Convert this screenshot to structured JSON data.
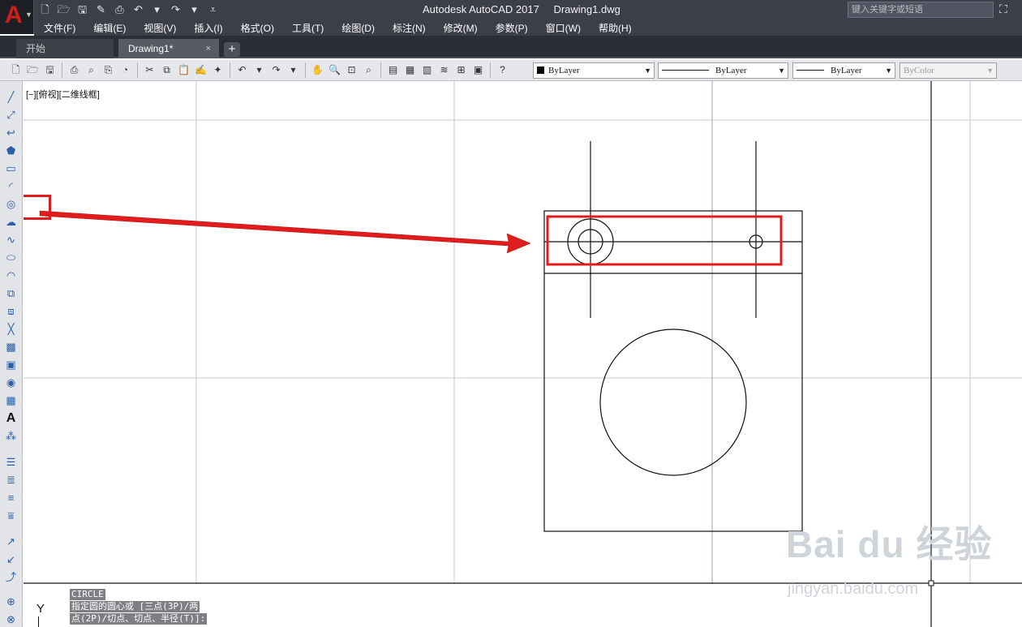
{
  "titlebar": {
    "app": "Autodesk AutoCAD 2017",
    "file": "Drawing1.dwg",
    "search_placeholder": "键入关键字或短语",
    "logo": "A"
  },
  "menu": [
    "文件(F)",
    "编辑(E)",
    "视图(V)",
    "插入(I)",
    "格式(O)",
    "工具(T)",
    "绘图(D)",
    "标注(N)",
    "修改(M)",
    "参数(P)",
    "窗口(W)",
    "帮助(H)"
  ],
  "tabs": {
    "start": "开始",
    "drawing": "Drawing1*",
    "close": "×",
    "add": "+"
  },
  "properties": {
    "color": "ByLayer",
    "linetype": "ByLayer",
    "lineweight": "ByLayer",
    "plotstyle": "ByColor"
  },
  "viewport_label": "[−][俯视][二维线框]",
  "command": {
    "name": "CIRCLE",
    "prompt_line1": "指定圆的圆心或 [三点(3P)/两",
    "prompt_line2": "点(2P)/切点、切点、半径(T)]:"
  },
  "ucs_label": "Y",
  "watermark": {
    "text": "Bai du 经验",
    "url": "jingyan.baidu.com"
  },
  "colors": {
    "highlight": "#e11c1c",
    "title_bg": "#3b3f49",
    "tab_active": "#565b66"
  }
}
